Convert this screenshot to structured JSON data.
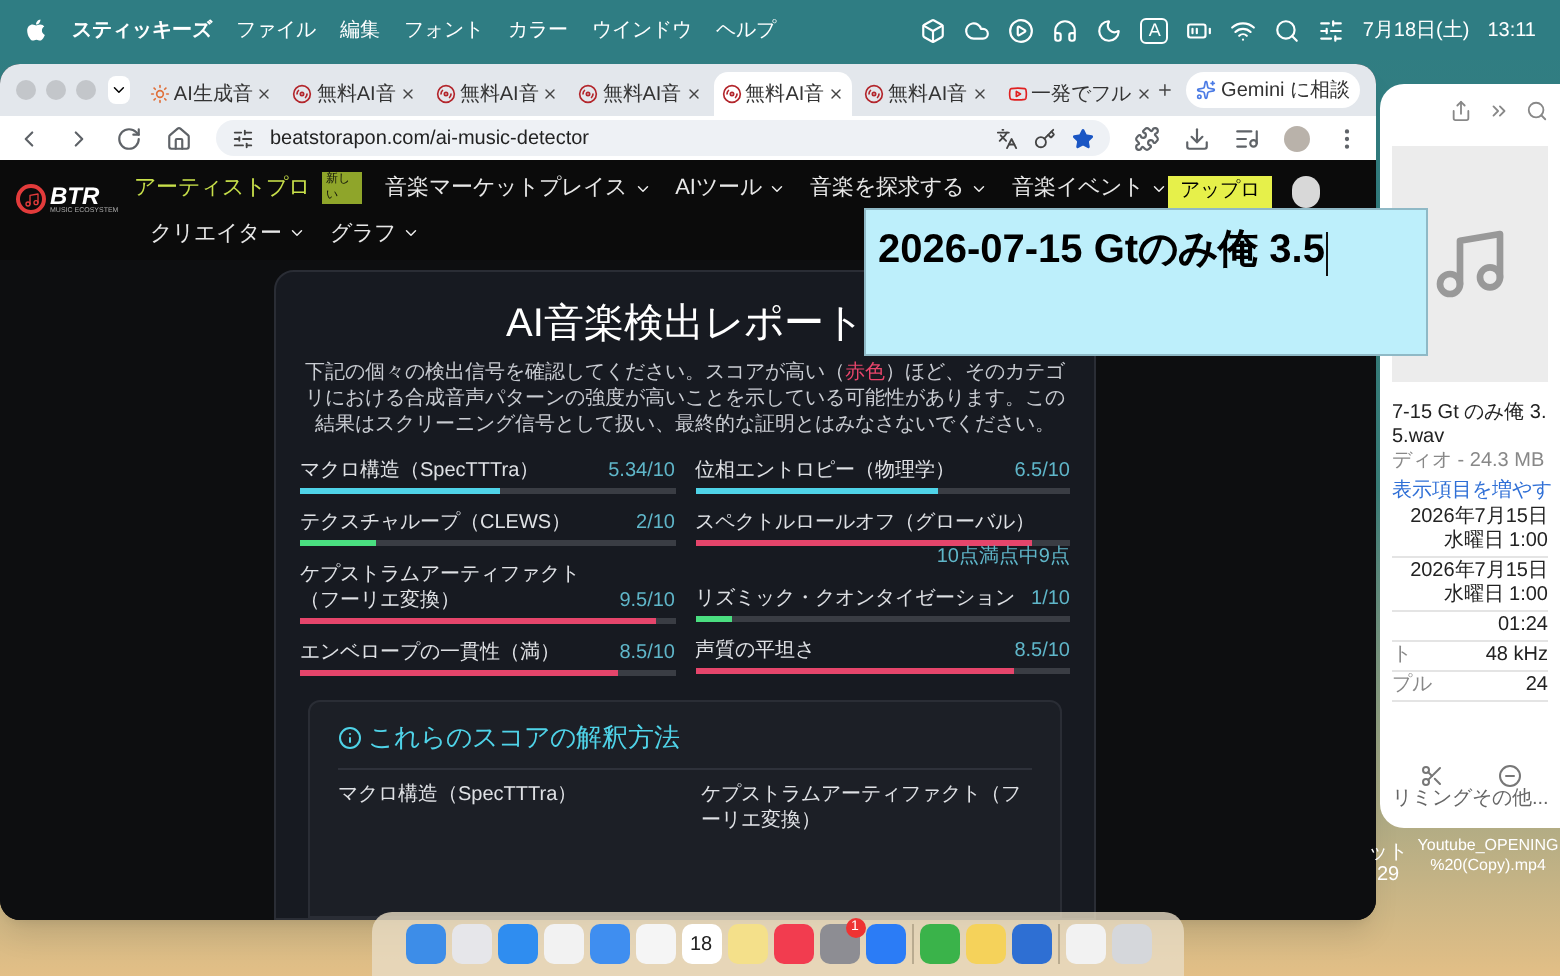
{
  "menu_bar": {
    "app": "スティッキーズ",
    "menus": [
      "ファイル",
      "編集",
      "フォント",
      "カラー",
      "ウインドウ",
      "ヘルプ"
    ],
    "input_mode": "A",
    "date": "7月18日(土)",
    "time": "13:11"
  },
  "browser": {
    "tabs": [
      {
        "label": "AI生成音",
        "kind": "sun",
        "selected": false
      },
      {
        "label": "無料AI音",
        "kind": "record",
        "selected": false
      },
      {
        "label": "無料AI音",
        "kind": "record",
        "selected": false
      },
      {
        "label": "無料AI音",
        "kind": "record",
        "selected": false
      },
      {
        "label": "無料AI音",
        "kind": "record",
        "selected": true
      },
      {
        "label": "無料AI音",
        "kind": "record",
        "selected": false
      },
      {
        "label": "一発でフル",
        "kind": "video",
        "selected": false
      }
    ],
    "gemini": "Gemini に相談",
    "url": "beatstorapon.com/ai-music-detector"
  },
  "site_nav": {
    "logo": "BTR",
    "logo_sub": "MUSIC ECOSYSTEM",
    "rows": [
      [
        {
          "label": "アーティストプロ",
          "kind": "highlight",
          "badge": "新しい"
        },
        {
          "label": "音楽マーケットプレイス",
          "kind": "dropdown"
        },
        {
          "label": "AIツール",
          "kind": "dropdown"
        },
        {
          "label": "音楽を探求する",
          "kind": "dropdown"
        },
        {
          "label": "音楽イベント",
          "kind": "dropdown"
        }
      ],
      [
        {
          "label": "クリエイター",
          "kind": "dropdown"
        },
        {
          "label": "グラフ",
          "kind": "dropdown"
        }
      ]
    ],
    "upload": "アップロ"
  },
  "report": {
    "title": "AI音楽検出レポート",
    "description": {
      "before": "下記の個々の検出信号を確認してください。スコアが高い（",
      "highlight": "赤色",
      "after": "）ほど、そのカテゴリにおける合成音声パターンの強度が高いことを示している可能性があります。この結果はスクリーニング信号として扱い、最終的な証明とはみなさないでください。"
    },
    "columns": [
      [
        {
          "label": "マクロ構造（SpecTTTra）",
          "reading": "5.34/10",
          "level": 0.534,
          "color": "#4fd3e8",
          "kind": "inline"
        },
        {
          "label": "テクスチャループ（CLEWS）",
          "reading": "2/10",
          "level": 0.2,
          "color": "#4ade80",
          "kind": "inline"
        },
        {
          "label": "ケプストラムアーティファクト（フーリエ変換）",
          "reading": "9.5/10",
          "level": 0.95,
          "color": "#e5456b",
          "kind": "inline"
        },
        {
          "label": "エンベロープの一貫性（満）",
          "reading": "8.5/10",
          "level": 0.85,
          "color": "#e5456b",
          "kind": "inline"
        }
      ],
      [
        {
          "label": "位相エントロピー（物理学）",
          "reading": "6.5/10",
          "level": 0.65,
          "color": "#4fd3e8",
          "kind": "inline"
        },
        {
          "label": "スペクトルロールオフ（グローバル）",
          "reading": "10点満点中9点",
          "level": 0.9,
          "color": "#e5456b",
          "kind": "below"
        },
        {
          "label": "リズミック・クオンタイゼーション",
          "reading": "1/10",
          "level": 0.1,
          "color": "#4ade80",
          "kind": "inline"
        },
        {
          "label": "声質の平坦さ",
          "reading": "8.5/10",
          "level": 0.85,
          "color": "#e5456b",
          "kind": "inline"
        }
      ]
    ],
    "interpretation": {
      "title": "これらのスコアの解釈方法",
      "items": [
        "マクロ構造（SpecTTTra）",
        "ケプストラムアーティファクト（フーリエ変換）"
      ]
    }
  },
  "sticky_note": {
    "text": "2026-07-15 Gtのみ俺 3.5"
  },
  "info_panel": {
    "filename": "7-15 Gt のみ俺 3.5.wav",
    "subtitle": "ディオ - 24.3 MB",
    "more_link": "表示項目を増やす",
    "rows": [
      {
        "value": [
          "2026年7月15日",
          "水曜日 1:00"
        ]
      },
      {
        "value": [
          "2026年7月15日",
          "水曜日 1:00"
        ]
      },
      {
        "value": [
          "01:24"
        ]
      },
      {
        "label": "ト",
        "value": [
          "48 kHz"
        ]
      },
      {
        "label": "プル",
        "value": [
          "24"
        ]
      }
    ],
    "actions": [
      {
        "label": "リミング",
        "kind": "trim"
      },
      {
        "label": "その他...",
        "kind": "more"
      }
    ]
  },
  "desktop_items": {
    "fragment": [
      "ット",
      "29"
    ],
    "file_name": [
      "Youtube_OPENING",
      "%20(Copy).mp4"
    ]
  },
  "dock": {
    "calendar_day": "18",
    "badge": "1"
  }
}
